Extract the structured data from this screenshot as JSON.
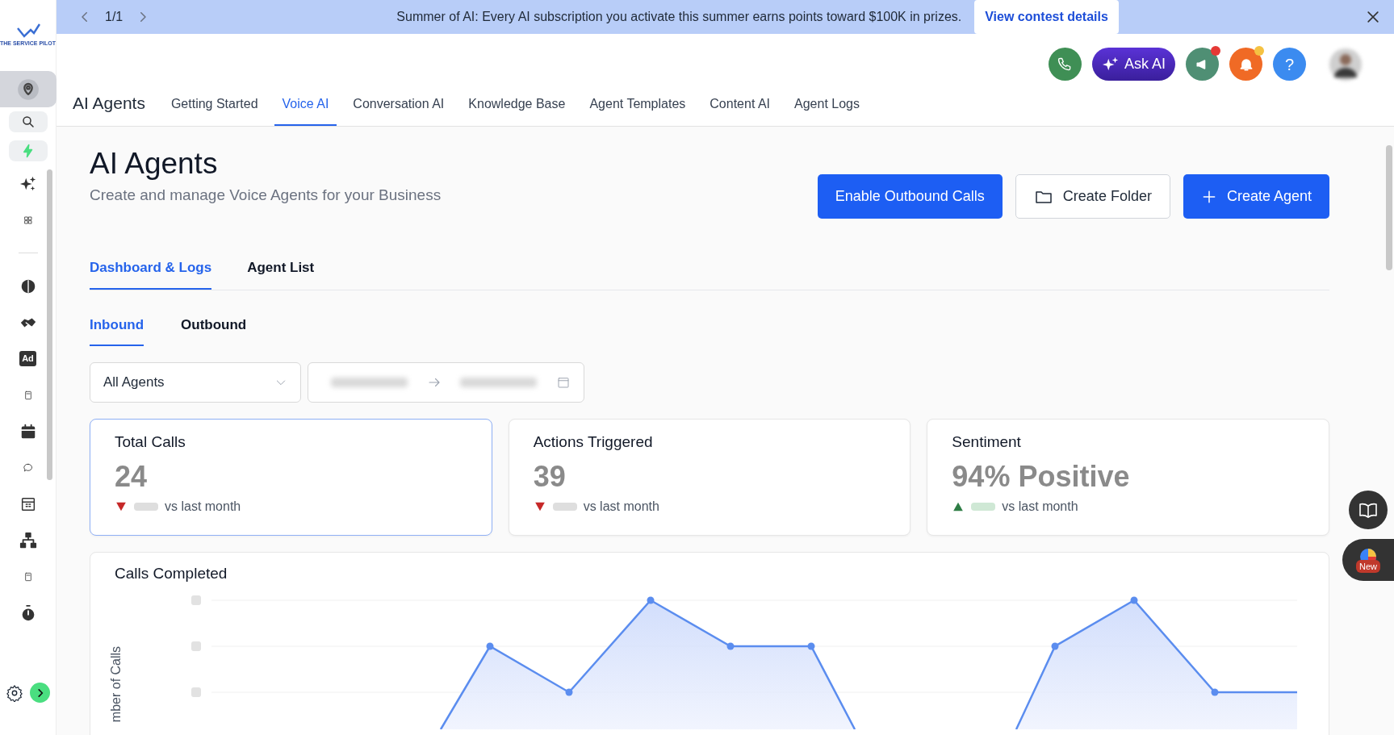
{
  "banner": {
    "pager": "1/1",
    "message": "Summer of AI: Every AI subscription you activate this summer earns points toward $100K in prizes.",
    "link": "View contest details"
  },
  "logo": {
    "text": "THE SERVICE PILOT"
  },
  "sidebar": {
    "items": [
      {
        "kind": "location",
        "selected": true
      },
      {
        "kind": "search",
        "selected": false
      },
      {
        "kind": "bolt",
        "selected": false
      },
      {
        "kind": "sparkles",
        "selected": false
      },
      {
        "kind": "grid",
        "selected": false
      },
      {
        "kind": "divider"
      },
      {
        "kind": "brain",
        "selected": false
      },
      {
        "kind": "handshake",
        "selected": false
      },
      {
        "kind": "ad",
        "selected": false,
        "label": "Ad"
      },
      {
        "kind": "doc",
        "selected": false
      },
      {
        "kind": "calendar",
        "selected": false
      },
      {
        "kind": "chat",
        "selected": false
      },
      {
        "kind": "table",
        "selected": false
      },
      {
        "kind": "sitemap",
        "selected": false
      },
      {
        "kind": "doc",
        "selected": false
      },
      {
        "kind": "timer",
        "selected": false
      }
    ]
  },
  "header": {
    "ask_ai": "Ask AI",
    "help": "?"
  },
  "app_title": "AI Agents",
  "nav_tabs": [
    {
      "label": "Getting Started",
      "selected": false
    },
    {
      "label": "Voice AI",
      "selected": true
    },
    {
      "label": "Conversation AI",
      "selected": false
    },
    {
      "label": "Knowledge Base",
      "selected": false
    },
    {
      "label": "Agent Templates",
      "selected": false
    },
    {
      "label": "Content AI",
      "selected": false
    },
    {
      "label": "Agent Logs",
      "selected": false
    }
  ],
  "page": {
    "title": "AI Agents",
    "subtitle": "Create and manage Voice Agents for your Business",
    "buttons": [
      {
        "label": "Enable Outbound Calls",
        "kind": "primary"
      },
      {
        "label": "Create Folder",
        "kind": "folder"
      },
      {
        "label": "Create Agent",
        "kind": "add"
      }
    ]
  },
  "section_tabs": [
    {
      "label": "Dashboard & Logs",
      "selected": true
    },
    {
      "label": "Agent List",
      "selected": false
    }
  ],
  "direction_tabs": [
    {
      "label": "Inbound",
      "selected": true
    },
    {
      "label": "Outbound",
      "selected": false
    }
  ],
  "filters": {
    "agent": "All Agents"
  },
  "cards": [
    {
      "title": "Total Calls",
      "value": "24",
      "rising": false,
      "comparison": "vs last month",
      "selected": true
    },
    {
      "title": "Actions Triggered",
      "value": "39",
      "rising": false,
      "comparison": "vs last month",
      "selected": false
    },
    {
      "title": "Sentiment",
      "value": "94% Positive",
      "rising": true,
      "comparison": "vs last month",
      "selected": false
    }
  ],
  "chart": {
    "title": "Calls Completed",
    "ylabel": "mber of Calls"
  },
  "floating": {
    "new_badge": "New"
  }
}
